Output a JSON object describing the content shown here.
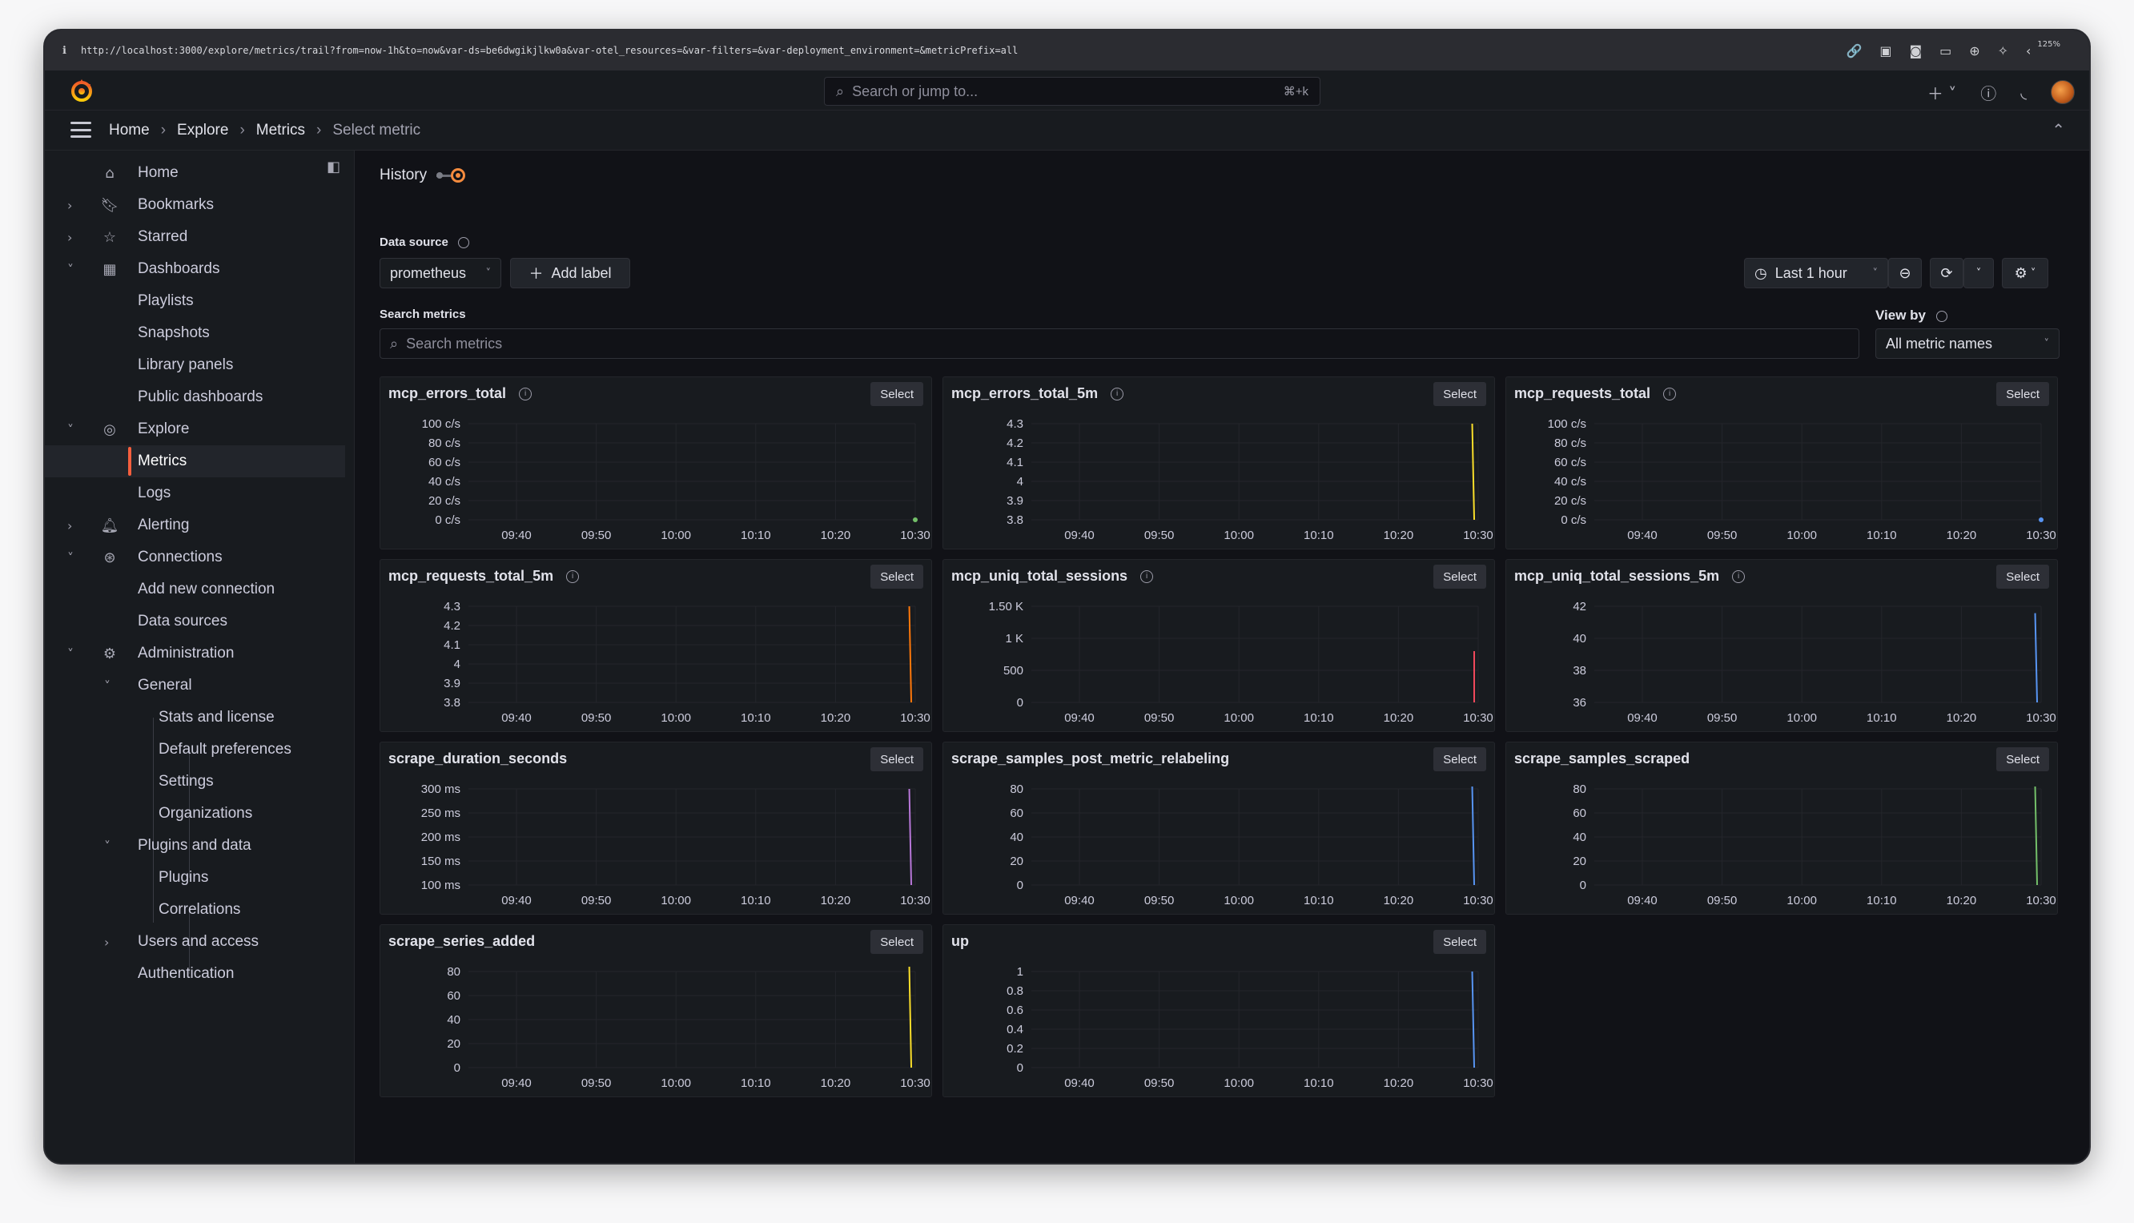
{
  "browser": {
    "url": "http://localhost:3000/explore/metrics/trail?from=now-1h&to=now&var-ds=be6dwgikjlkw0a&var-otel_resources=&var-filters=&var-deployment_environment=&metricPrefix=all",
    "zoom": "125%"
  },
  "topnav": {
    "search_placeholder": "Search or jump to...",
    "search_shortcut": "⌘+k"
  },
  "breadcrumbs": [
    "Home",
    "Explore",
    "Metrics",
    "Select metric"
  ],
  "sidebar": {
    "items": [
      {
        "label": "Home"
      },
      {
        "label": "Bookmarks"
      },
      {
        "label": "Starred"
      },
      {
        "label": "Dashboards"
      },
      {
        "label": "Playlists"
      },
      {
        "label": "Snapshots"
      },
      {
        "label": "Library panels"
      },
      {
        "label": "Public dashboards"
      },
      {
        "label": "Explore"
      },
      {
        "label": "Metrics"
      },
      {
        "label": "Logs"
      },
      {
        "label": "Alerting"
      },
      {
        "label": "Connections"
      },
      {
        "label": "Add new connection"
      },
      {
        "label": "Data sources"
      },
      {
        "label": "Administration"
      },
      {
        "label": "General"
      },
      {
        "label": "Stats and license"
      },
      {
        "label": "Default preferences"
      },
      {
        "label": "Settings"
      },
      {
        "label": "Organizations"
      },
      {
        "label": "Plugins and data"
      },
      {
        "label": "Plugins"
      },
      {
        "label": "Correlations"
      },
      {
        "label": "Users and access"
      },
      {
        "label": "Authentication"
      }
    ]
  },
  "main": {
    "history_label": "History",
    "datasource_label": "Data source",
    "datasource_value": "prometheus",
    "add_label": "Add label",
    "time_range": "Last 1 hour",
    "search_label": "Search metrics",
    "search_placeholder": "Search metrics",
    "view_by_label": "View by",
    "view_by_value": "All metric names",
    "select_label": "Select"
  },
  "colors": {
    "accent": "#f55f3e",
    "background": "#111217",
    "panel": "#181b1f"
  },
  "chart_data": [
    {
      "type": "line",
      "title": "mcp_errors_total",
      "x_ticks": [
        "09:40",
        "09:50",
        "10:00",
        "10:10",
        "10:20",
        "10:30"
      ],
      "y_ticks": [
        "100 c/s",
        "80 c/s",
        "60 c/s",
        "40 c/s",
        "20 c/s",
        "0 c/s"
      ],
      "ylim": [
        0,
        100
      ],
      "series": [
        {
          "color": "#73bf69",
          "points": [
            [
              1.0,
              0
            ]
          ]
        }
      ],
      "grid": true
    },
    {
      "type": "line",
      "title": "mcp_errors_total_5m",
      "x_ticks": [
        "09:40",
        "09:50",
        "10:00",
        "10:10",
        "10:20",
        "10:30"
      ],
      "y_ticks": [
        "4.3",
        "4.2",
        "4.1",
        "4",
        "3.9",
        "3.8"
      ],
      "ylim": [
        3.8,
        4.3
      ],
      "series": [
        {
          "color": "#fade2a",
          "points": [
            [
              0.985,
              4.3
            ],
            [
              0.99,
              3.8
            ]
          ]
        }
      ],
      "grid": true
    },
    {
      "type": "line",
      "title": "mcp_requests_total",
      "x_ticks": [
        "09:40",
        "09:50",
        "10:00",
        "10:10",
        "10:20",
        "10:30"
      ],
      "y_ticks": [
        "100 c/s",
        "80 c/s",
        "60 c/s",
        "40 c/s",
        "20 c/s",
        "0 c/s"
      ],
      "ylim": [
        0,
        100
      ],
      "series": [
        {
          "color": "#5794f2",
          "points": [
            [
              1.0,
              0
            ]
          ]
        }
      ],
      "grid": true
    },
    {
      "type": "line",
      "title": "mcp_requests_total_5m",
      "x_ticks": [
        "09:40",
        "09:50",
        "10:00",
        "10:10",
        "10:20",
        "10:30"
      ],
      "y_ticks": [
        "4.3",
        "4.2",
        "4.1",
        "4",
        "3.9",
        "3.8"
      ],
      "ylim": [
        3.8,
        4.3
      ],
      "series": [
        {
          "color": "#ff780a",
          "points": [
            [
              0.985,
              4.3
            ],
            [
              0.99,
              3.8
            ]
          ]
        }
      ],
      "grid": true
    },
    {
      "type": "line",
      "title": "mcp_uniq_total_sessions",
      "x_ticks": [
        "09:40",
        "09:50",
        "10:00",
        "10:10",
        "10:20",
        "10:30"
      ],
      "y_ticks": [
        "1.50 K",
        "1 K",
        "500",
        "0"
      ],
      "ylim": [
        0,
        1500
      ],
      "series": [
        {
          "color": "#f2495c",
          "points": [
            [
              0.99,
              800
            ],
            [
              0.99,
              0
            ]
          ]
        }
      ],
      "grid": true
    },
    {
      "type": "line",
      "title": "mcp_uniq_total_sessions_5m",
      "x_ticks": [
        "09:40",
        "09:50",
        "10:00",
        "10:10",
        "10:20",
        "10:30"
      ],
      "y_ticks": [
        "42",
        "40",
        "38",
        "36"
      ],
      "ylim": [
        35.5,
        42.5
      ],
      "series": [
        {
          "color": "#5794f2",
          "points": [
            [
              0.985,
              42
            ],
            [
              0.99,
              35.5
            ]
          ]
        }
      ],
      "grid": true
    },
    {
      "type": "line",
      "title": "scrape_duration_seconds",
      "x_ticks": [
        "09:40",
        "09:50",
        "10:00",
        "10:10",
        "10:20",
        "10:30"
      ],
      "y_ticks": [
        "300 ms",
        "250 ms",
        "200 ms",
        "150 ms",
        "100 ms"
      ],
      "ylim": [
        80,
        300
      ],
      "series": [
        {
          "color": "#b877d9",
          "points": [
            [
              0.985,
              300
            ],
            [
              0.99,
              80
            ]
          ]
        }
      ],
      "grid": true
    },
    {
      "type": "line",
      "title": "scrape_samples_post_metric_relabeling",
      "x_ticks": [
        "09:40",
        "09:50",
        "10:00",
        "10:10",
        "10:20",
        "10:30"
      ],
      "y_ticks": [
        "80",
        "60",
        "40",
        "20",
        "0"
      ],
      "ylim": [
        0,
        80
      ],
      "series": [
        {
          "color": "#5794f2",
          "points": [
            [
              0.985,
              82
            ],
            [
              0.99,
              0
            ]
          ]
        }
      ],
      "grid": true
    },
    {
      "type": "line",
      "title": "scrape_samples_scraped",
      "x_ticks": [
        "09:40",
        "09:50",
        "10:00",
        "10:10",
        "10:20",
        "10:30"
      ],
      "y_ticks": [
        "80",
        "60",
        "40",
        "20",
        "0"
      ],
      "ylim": [
        0,
        80
      ],
      "series": [
        {
          "color": "#73bf69",
          "points": [
            [
              0.985,
              82
            ],
            [
              0.99,
              0
            ]
          ]
        }
      ],
      "grid": true
    },
    {
      "type": "line",
      "title": "scrape_series_added",
      "x_ticks": [
        "09:40",
        "09:50",
        "10:00",
        "10:10",
        "10:20",
        "10:30"
      ],
      "y_ticks": [
        "80",
        "60",
        "40",
        "20",
        "0"
      ],
      "ylim": [
        0,
        80
      ],
      "series": [
        {
          "color": "#fade2a",
          "points": [
            [
              0.985,
              85
            ],
            [
              0.99,
              0
            ]
          ]
        }
      ],
      "grid": true
    },
    {
      "type": "line",
      "title": "up",
      "x_ticks": [
        "09:40",
        "09:50",
        "10:00",
        "10:10",
        "10:20",
        "10:30"
      ],
      "y_ticks": [
        "1",
        "0.8",
        "0.6",
        "0.4",
        "0.2",
        "0"
      ],
      "ylim": [
        0,
        1
      ],
      "series": [
        {
          "color": "#5794f2",
          "points": [
            [
              0.985,
              1
            ],
            [
              0.99,
              0
            ]
          ]
        }
      ],
      "grid": true
    }
  ]
}
